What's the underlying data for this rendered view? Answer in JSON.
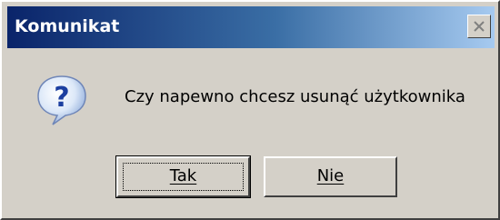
{
  "dialog": {
    "title": "Komunikat",
    "message": "Czy napewno chcesz usunąć użytkownika",
    "icon": "question-icon",
    "buttons": {
      "yes_label": "Tak",
      "no_label": "Nie"
    }
  },
  "colors": {
    "titlebar_start": "#0a246a",
    "titlebar_end": "#a6caf0",
    "face": "#d4d0c8"
  }
}
